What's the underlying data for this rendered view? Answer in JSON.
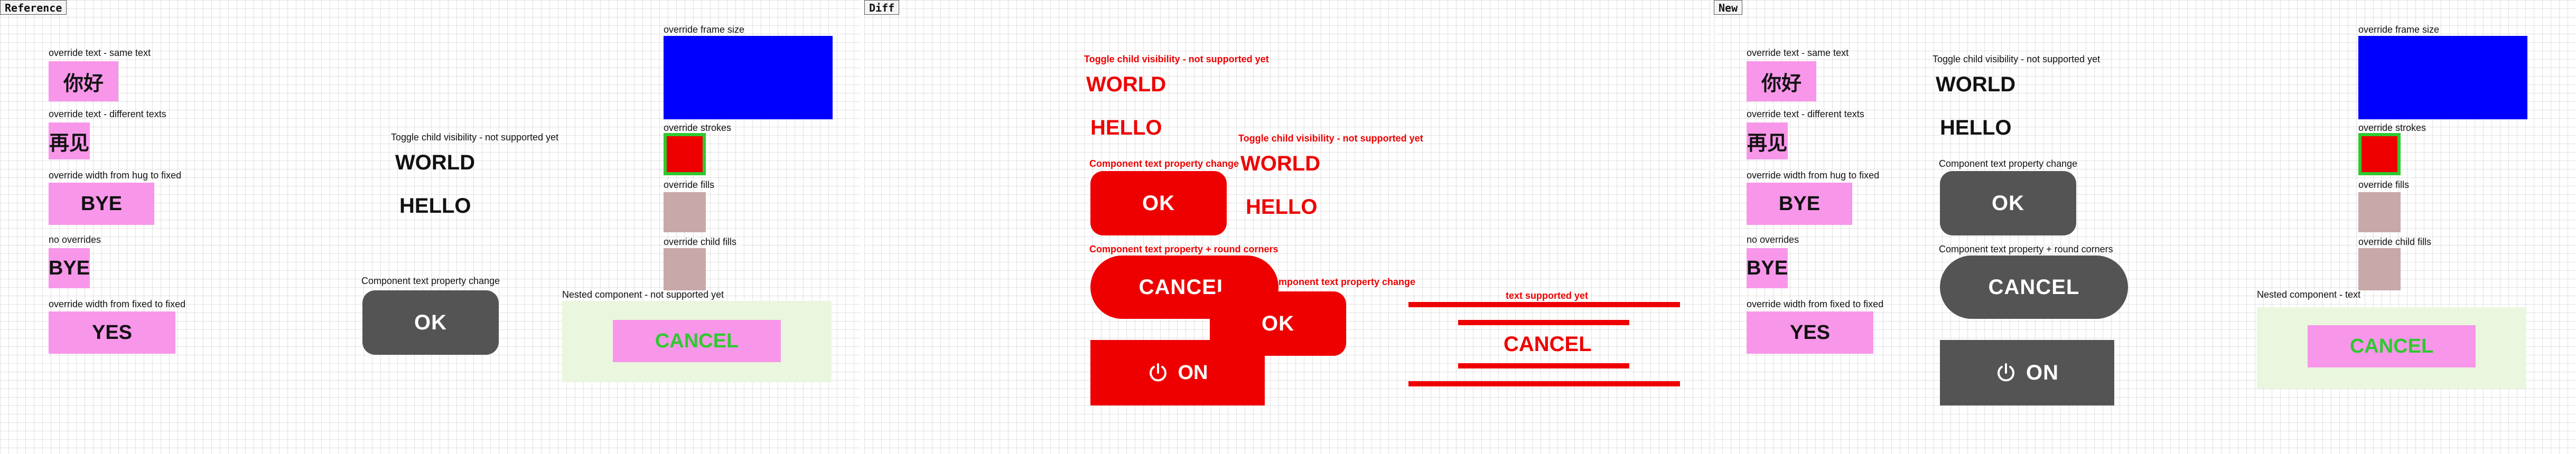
{
  "panels": {
    "reference": "Reference",
    "diff": "Diff",
    "new": "New"
  },
  "labels": {
    "same_text": "override text - same text",
    "different_texts": "override text - different texts",
    "width_hug_to_fixed": "override width from hug to fixed",
    "no_overrides": "no overrides",
    "width_fixed_to_fixed": "override width from fixed to fixed",
    "toggle_child": "Toggle child visibility - not supported yet",
    "component_text_property_change": "Component text  property change",
    "component_text_round_corners": "Component text  property + round corners",
    "override_frame_size": "override frame size",
    "override_strokes": "override strokes",
    "override_fills": "override fills",
    "override_child_fills": "override child fills",
    "nested_not_supported": "Nested component - not supported yet",
    "nested_text": "Nested component - text",
    "diff_text_not_supported": "text supported yet"
  },
  "values": {
    "nihao": "你好",
    "zaijian": "再见",
    "bye": "BYE",
    "yes": "YES",
    "world": "WORLD",
    "hello": "HELLO",
    "ok": "OK",
    "cancel": "CANCEL",
    "on": "ON"
  },
  "colors": {
    "pink": "#f896ea",
    "blue": "#0000ff",
    "red": "#ee0000",
    "green_stroke": "#2fc92f",
    "muted_fill": "#c8a8a8",
    "dark_button": "#545454",
    "nested_bg": "#eaf7de",
    "diff_red": "#ee0000"
  },
  "icons": {
    "power": "power-icon"
  }
}
